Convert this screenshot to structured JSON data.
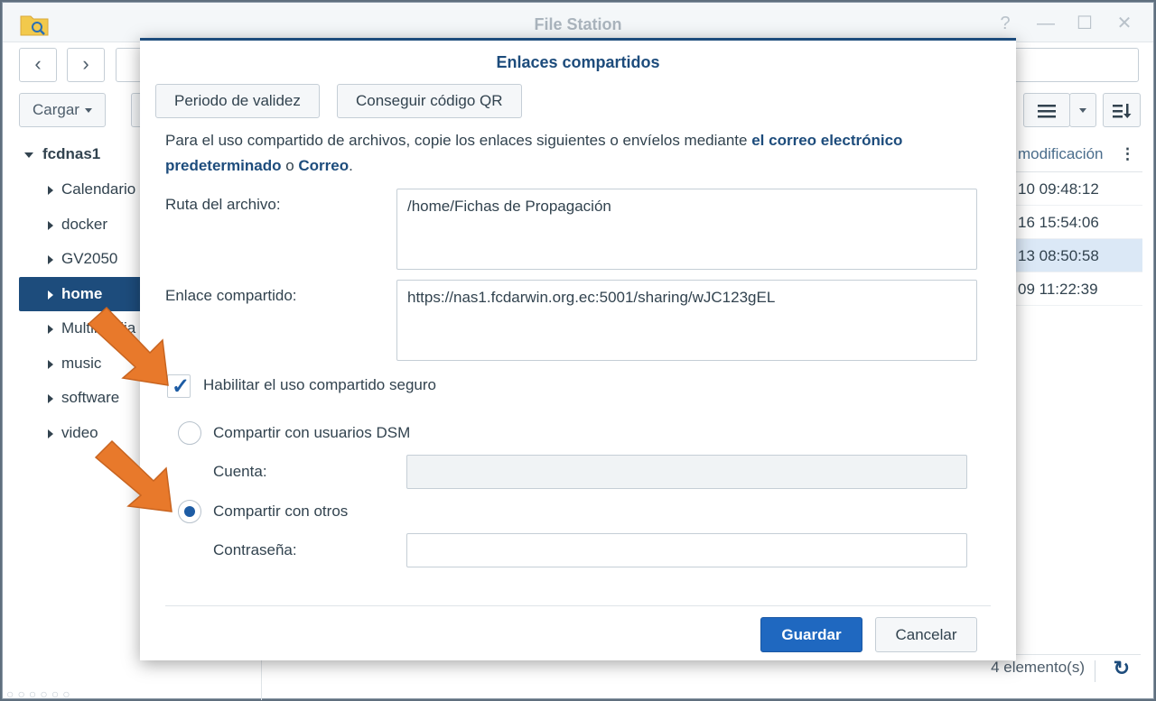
{
  "window": {
    "title": "File Station",
    "controls": {
      "help": "?",
      "minimize": "—",
      "maximize": "☐",
      "close": "✕"
    }
  },
  "toolbar": {
    "back": "‹",
    "forward": "›",
    "upload_label": "Cargar"
  },
  "sidebar": {
    "root": "fcdnas1",
    "items": [
      {
        "label": "Calendario"
      },
      {
        "label": "docker"
      },
      {
        "label": "GV2050"
      },
      {
        "label": "home",
        "selected": true
      },
      {
        "label": "Multimedia"
      },
      {
        "label": "music"
      },
      {
        "label": "software"
      },
      {
        "label": "video"
      }
    ]
  },
  "file_list": {
    "column_header": "modificación",
    "rows": [
      {
        "time": "10 09:48:12"
      },
      {
        "time": "16 15:54:06"
      },
      {
        "time": "13 08:50:58",
        "selected": true
      },
      {
        "time": "09 11:22:39"
      }
    ],
    "status_count": "4 elemento(s)"
  },
  "modal": {
    "title": "Enlaces compartidos",
    "tab_validity": "Periodo de validez",
    "tab_qr": "Conseguir código QR",
    "description_part1": "Para el uso compartido de archivos, copie los enlaces siguientes o envíelos mediante ",
    "description_bold1": "el correo electrónico predeterminado",
    "description_part2": " o ",
    "description_bold2": "Correo",
    "description_part3": ".",
    "path_label": "Ruta del archivo:",
    "path_value": "/home/Fichas de Propagación",
    "link_label": "Enlace compartido:",
    "link_value": "https://nas1.fcdarwin.org.ec:5001/sharing/wJC123gEL",
    "secure_share_label": "Habilitar el uso compartido seguro",
    "secure_share_checked": true,
    "option_dsm_label": "Compartir con usuarios DSM",
    "account_label": "Cuenta:",
    "option_others_label": "Compartir con otros",
    "option_others_selected": true,
    "password_label": "Contraseña:",
    "save_label": "Guardar",
    "cancel_label": "Cancelar"
  },
  "colors": {
    "accent": "#1d4c7c",
    "primary_button": "#1f68c0",
    "annotation_arrow": "#e8792b"
  }
}
